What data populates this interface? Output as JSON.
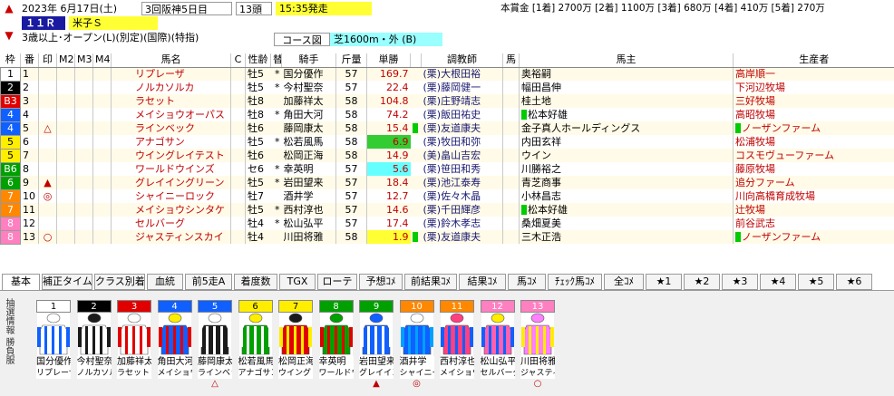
{
  "header": {
    "date": "2023年 6月17日(土)",
    "meeting": "3回阪神5日目",
    "runners": "13頭",
    "post_time": "15:35発走",
    "race_no": "１１Ｒ",
    "race_name": "米子Ｓ",
    "conditions": "3歳以上･オープン(L)(別定)(国際)(特指)",
    "course_label": "コース図",
    "course": "芝1600m・外 (B)",
    "prize": "本賞金 [1着] 2700万 [2着] 1100万 [3着] 680万 [4着] 410万 [5着] 270万"
  },
  "columns": [
    "枠",
    "番",
    "印",
    "M2",
    "M3",
    "M4",
    "馬名",
    "C",
    "性齢",
    "替",
    "騎手",
    "斤量",
    "単勝",
    "",
    "調教師",
    "馬",
    "馬主",
    "生産者"
  ],
  "rows": [
    {
      "waku": "1",
      "num": "1",
      "mark": "",
      "name": "リプレーザ",
      "sexage": "牡5",
      "change": "*",
      "jockey": "国分優作",
      "weight": "57",
      "odds": "169.7",
      "odds_hl": "",
      "trmark": "",
      "trainer": "(栗)大根田裕",
      "owner": "奥裕嗣",
      "ownermark": "",
      "breeder": "高岸順一",
      "breedermark": ""
    },
    {
      "waku": "2",
      "num": "2",
      "mark": "",
      "name": "ノルカソルカ",
      "sexage": "牡5",
      "change": "*",
      "jockey": "今村聖奈",
      "weight": "57",
      "odds": "22.4",
      "odds_hl": "",
      "trmark": "",
      "trainer": "(栗)藤岡健一",
      "owner": "幅田昌伸",
      "ownermark": "",
      "breeder": "下河辺牧場",
      "breedermark": ""
    },
    {
      "waku": "3",
      "num": "3",
      "mark": "",
      "name": "ラセット",
      "sexage": "牡8",
      "change": "",
      "jockey": "加藤祥太",
      "weight": "58",
      "odds": "104.8",
      "odds_hl": "",
      "trmark": "",
      "trainer": "(栗)庄野靖志",
      "owner": "桂土地",
      "ownermark": "",
      "breeder": "三好牧場",
      "breedermark": ""
    },
    {
      "waku": "4",
      "num": "4",
      "mark": "",
      "name": "メイショウオーパス",
      "sexage": "牡8",
      "change": "*",
      "jockey": "角田大河",
      "weight": "58",
      "odds": "74.2",
      "odds_hl": "",
      "trmark": "",
      "trainer": "(栗)飯田祐史",
      "owner": "松本好雄",
      "ownermark": "*",
      "breeder": "高昭牧場",
      "breedermark": ""
    },
    {
      "waku": "4",
      "num": "5",
      "mark": "△",
      "name": "ラインベック",
      "sexage": "牡6",
      "change": "",
      "jockey": "藤岡康太",
      "weight": "58",
      "odds": "15.4",
      "odds_hl": "",
      "trmark": "*",
      "trainer": "(栗)友道康夫",
      "owner": "金子真人ホールディングス",
      "ownermark": "",
      "breeder": "ノーザンファーム",
      "breedermark": "*"
    },
    {
      "waku": "5",
      "num": "6",
      "mark": "",
      "name": "アナゴサン",
      "sexage": "牡5",
      "change": "*",
      "jockey": "松若風馬",
      "weight": "58",
      "odds": "6.9",
      "odds_hl": "g",
      "trmark": "",
      "trainer": "(栗)牧田和弥",
      "owner": "内田玄祥",
      "ownermark": "",
      "breeder": "松浦牧場",
      "breedermark": ""
    },
    {
      "waku": "5",
      "num": "7",
      "mark": "",
      "name": "ウイングレイテスト",
      "sexage": "牡6",
      "change": "",
      "jockey": "松岡正海",
      "weight": "58",
      "odds": "14.9",
      "odds_hl": "",
      "trmark": "",
      "trainer": "(美)畠山吉宏",
      "owner": "ウイン",
      "ownermark": "",
      "breeder": "コスモヴューファーム",
      "breedermark": ""
    },
    {
      "waku": "6",
      "num": "8",
      "mark": "",
      "name": "ワールドウインズ",
      "sexage": "セ6",
      "change": "*",
      "jockey": "幸英明",
      "weight": "57",
      "odds": "5.6",
      "odds_hl": "c",
      "trmark": "",
      "trainer": "(栗)笹田和秀",
      "owner": "川勝裕之",
      "ownermark": "",
      "breeder": "藤原牧場",
      "breedermark": ""
    },
    {
      "waku": "6",
      "num": "9",
      "mark": "▲",
      "name": "グレイイングリーン",
      "sexage": "牡5",
      "change": "*",
      "jockey": "岩田望来",
      "weight": "57",
      "odds": "18.4",
      "odds_hl": "",
      "trmark": "",
      "trainer": "(栗)池江泰寿",
      "owner": "青芝商事",
      "ownermark": "",
      "breeder": "追分ファーム",
      "breedermark": ""
    },
    {
      "waku": "7",
      "num": "10",
      "mark": "◎",
      "name": "シャイニーロック",
      "sexage": "牡7",
      "change": "",
      "jockey": "酒井学",
      "weight": "57",
      "odds": "12.7",
      "odds_hl": "",
      "trmark": "",
      "trainer": "(栗)佐々木晶",
      "owner": "小林昌志",
      "ownermark": "",
      "breeder": "川向高橋育成牧場",
      "breedermark": ""
    },
    {
      "waku": "7",
      "num": "11",
      "mark": "",
      "name": "メイショウシンタケ",
      "sexage": "牡5",
      "change": "*",
      "jockey": "西村淳也",
      "weight": "57",
      "odds": "14.6",
      "odds_hl": "",
      "trmark": "",
      "trainer": "(栗)千田輝彦",
      "owner": "松本好雄",
      "ownermark": "*",
      "breeder": "辻牧場",
      "breedermark": ""
    },
    {
      "waku": "8",
      "num": "12",
      "mark": "",
      "name": "セルバーグ",
      "sexage": "牡4",
      "change": "*",
      "jockey": "松山弘平",
      "weight": "57",
      "odds": "17.4",
      "odds_hl": "",
      "trmark": "",
      "trainer": "(栗)鈴木孝志",
      "owner": "桑畑夏美",
      "ownermark": "",
      "breeder": "前谷武志",
      "breedermark": ""
    },
    {
      "waku": "8",
      "num": "13",
      "mark": "○",
      "name": "ジャスティンスカイ",
      "sexage": "牡4",
      "change": "",
      "jockey": "川田将雅",
      "weight": "58",
      "odds": "1.9",
      "odds_hl": "y",
      "trmark": "*",
      "trainer": "(栗)友道康夫",
      "owner": "三木正浩",
      "ownermark": "",
      "breeder": "ノーザンファーム",
      "breedermark": "*"
    }
  ],
  "waku_colors": {
    "1": {
      "bg": "#ffffff",
      "fg": "#000000"
    },
    "2": {
      "bg": "#000000",
      "fg": "#ffffff"
    },
    "3": {
      "bg": "#e00000",
      "fg": "#ffffff"
    },
    "4": {
      "bg": "#1060ff",
      "fg": "#ffffff"
    },
    "5": {
      "bg": "#ffee00",
      "fg": "#000000"
    },
    "6": {
      "bg": "#00a000",
      "fg": "#ffffff"
    },
    "7": {
      "bg": "#ff8800",
      "fg": "#ffffff"
    },
    "8": {
      "bg": "#ff80c0",
      "fg": "#ffffff"
    }
  },
  "waku_labels": {
    "3": "B3",
    "6": "B6"
  },
  "tabs": [
    "基本",
    "補正タイム",
    "クラス別着",
    "血統",
    "前5走A",
    "着度数",
    "TGX",
    "ローテ",
    "予想ｺﾒ",
    "前結果ｺﾒ",
    "結果ｺﾒ",
    "馬ｺﾒ",
    "ﾁｪｯｸ馬ｺﾒ",
    "全ｺﾒ",
    "★1",
    "★2",
    "★3",
    "★4",
    "★5",
    "★6"
  ],
  "side_label": "抽選情報 勝負服",
  "silks": [
    {
      "num": "1",
      "jockey": "国分優作",
      "horse": "リプレーザ",
      "mark": "",
      "body": "#ffffff",
      "trim": "#1060ff",
      "cap": "#ffffff"
    },
    {
      "num": "2",
      "jockey": "今村聖奈",
      "horse": "ノルカソルカ",
      "mark": "",
      "body": "#ffffff",
      "trim": "#1a1a1a",
      "cap": "#1a1a1a"
    },
    {
      "num": "3",
      "jockey": "加藤祥太",
      "horse": "ラセット",
      "mark": "",
      "body": "#ffffff",
      "trim": "#e00000",
      "cap": "#ffffff"
    },
    {
      "num": "4",
      "jockey": "角田大河",
      "horse": "メイショウオーパス",
      "mark": "",
      "body": "#1060ff",
      "trim": "#e00000",
      "cap": "#ffee00"
    },
    {
      "num": "5",
      "jockey": "藤岡康太",
      "horse": "ラインベック",
      "mark": "△",
      "body": "#1a1a1a",
      "trim": "#ffffff",
      "cap": "#ffffff"
    },
    {
      "num": "6",
      "jockey": "松若風馬",
      "horse": "アナゴサン",
      "mark": "",
      "body": "#00a000",
      "trim": "#ffffff",
      "cap": "#ffee00"
    },
    {
      "num": "7",
      "jockey": "松岡正海",
      "horse": "ウイングレイテスト",
      "mark": "",
      "body": "#e00000",
      "trim": "#ffee00",
      "cap": "#1a1a1a"
    },
    {
      "num": "8",
      "jockey": "幸英明",
      "horse": "ワールドウインズ",
      "mark": "",
      "body": "#00a000",
      "trim": "#e00000",
      "cap": "#00a000"
    },
    {
      "num": "9",
      "jockey": "岩田望来",
      "horse": "グレイイングリーン",
      "mark": "▲",
      "body": "#1060ff",
      "trim": "#ffffff",
      "cap": "#1060ff"
    },
    {
      "num": "10",
      "jockey": "酒井学",
      "horse": "シャイニーロック",
      "mark": "◎",
      "body": "#1060ff",
      "trim": "#00a0ff",
      "cap": "#ffffff"
    },
    {
      "num": "11",
      "jockey": "西村淳也",
      "horse": "メイショウシンタケ",
      "mark": "",
      "body": "#ff4080",
      "trim": "#1060ff",
      "cap": "#ff4080"
    },
    {
      "num": "12",
      "jockey": "松山弘平",
      "horse": "セルバーグ",
      "mark": "",
      "body": "#ff60b0",
      "trim": "#1060ff",
      "cap": "#ffee00"
    },
    {
      "num": "13",
      "jockey": "川田将雅",
      "horse": "ジャスティンスカイ",
      "mark": "○",
      "body": "#ff80ff",
      "trim": "#ffee00",
      "cap": "#ff80ff"
    }
  ]
}
